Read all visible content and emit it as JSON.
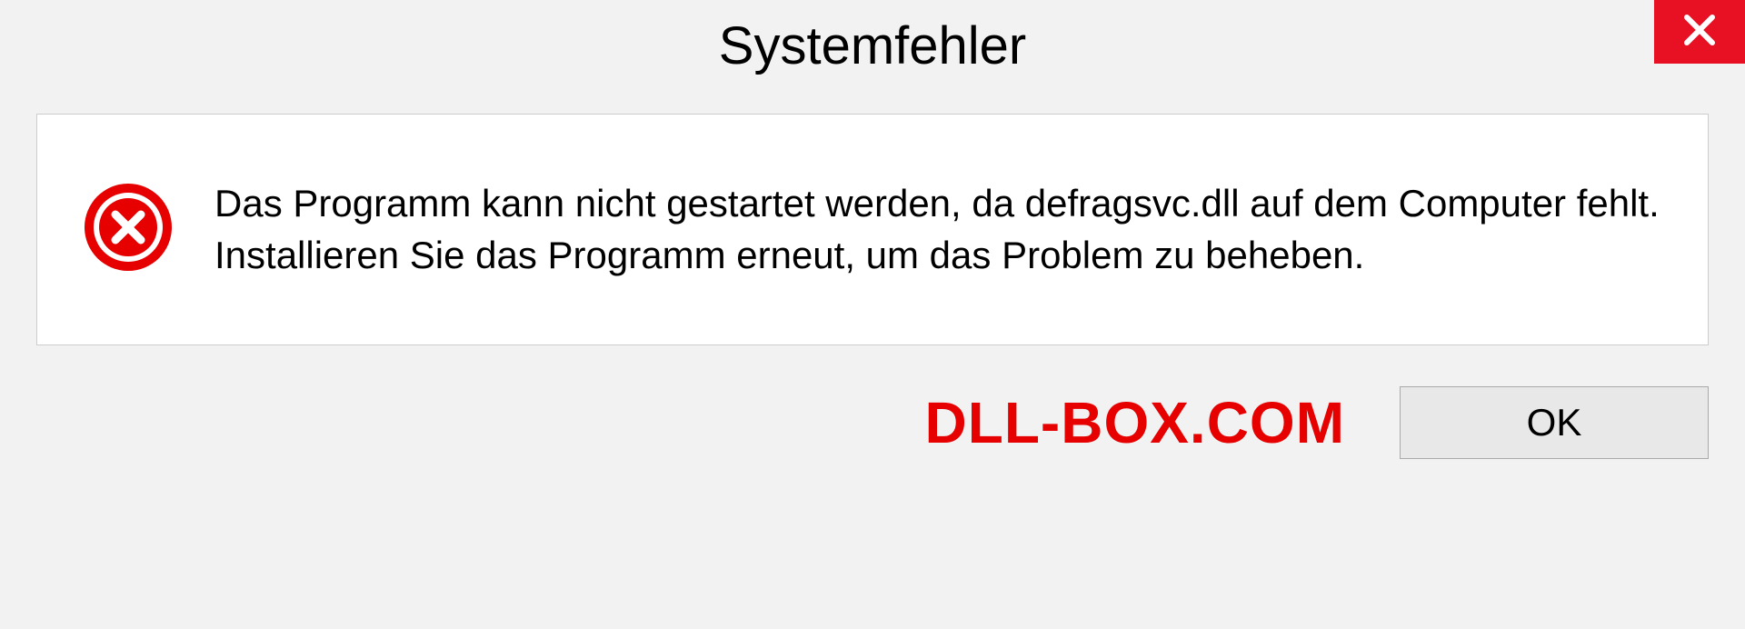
{
  "dialog": {
    "title": "Systemfehler",
    "message": "Das Programm kann nicht gestartet werden, da defragsvc.dll auf dem Computer fehlt. Installieren Sie das Programm erneut, um das Problem zu beheben.",
    "ok_label": "OK"
  },
  "watermark": "DLL-BOX.COM"
}
